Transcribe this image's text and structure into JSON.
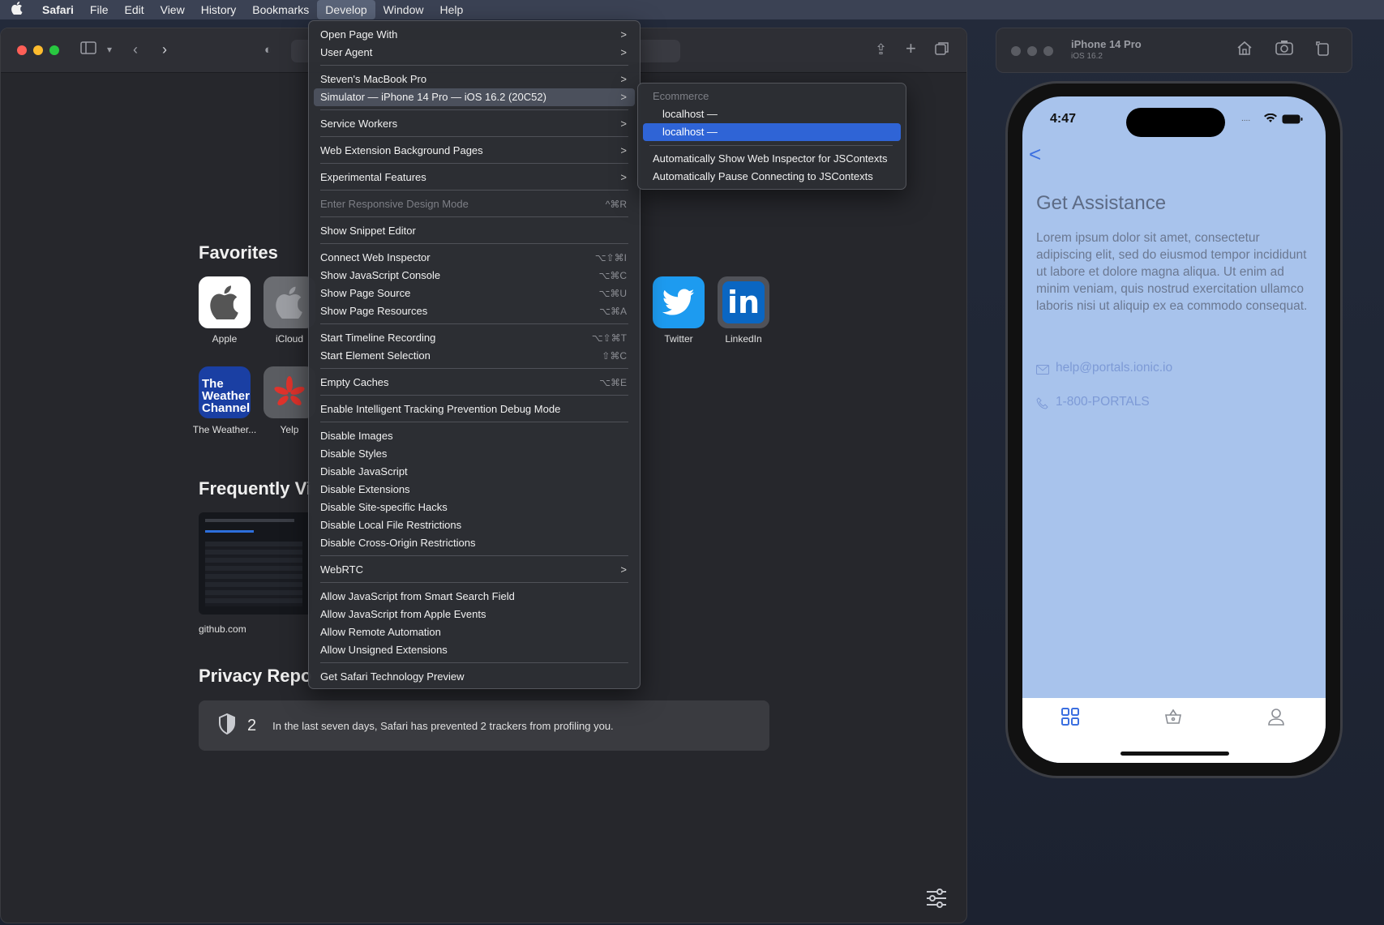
{
  "menubar": {
    "items": [
      "Safari",
      "File",
      "Edit",
      "View",
      "History",
      "Bookmarks",
      "Develop",
      "Window",
      "Help"
    ],
    "active": "Develop"
  },
  "safari": {
    "favorites_title": "Favorites",
    "favorites": [
      {
        "label": "Apple"
      },
      {
        "label": "iCloud"
      },
      {
        "label": "Twitter"
      },
      {
        "label": "LinkedIn"
      },
      {
        "label": "The Weather..."
      },
      {
        "label": "Yelp"
      }
    ],
    "weather_tile_text": "The Weather Channel",
    "linkedin_tile_text": "in",
    "frequently_title": "Frequently Vi",
    "frequent_site": "github.com",
    "privacy_title": "Privacy Repo",
    "privacy_count": "2",
    "privacy_text": "In the last seven days, Safari has prevented 2 trackers from profiling you."
  },
  "develop_menu": {
    "items": [
      {
        "label": "Open Page With",
        "arrow": ">"
      },
      {
        "label": "User Agent",
        "arrow": ">"
      },
      {
        "label": "Steven's MacBook Pro",
        "arrow": ">"
      },
      {
        "label": "Simulator — iPhone 14 Pro — iOS 16.2 (20C52)",
        "arrow": ">"
      },
      {
        "label": "Service Workers",
        "arrow": ">"
      },
      {
        "label": "Web Extension Background Pages",
        "arrow": ">"
      },
      {
        "label": "Experimental Features",
        "arrow": ">"
      },
      {
        "label": "Enter Responsive Design Mode",
        "shortcut": "^⌘R"
      },
      {
        "label": "Show Snippet Editor"
      },
      {
        "label": "Connect Web Inspector",
        "shortcut": "⌥⇧⌘I"
      },
      {
        "label": "Show JavaScript Console",
        "shortcut": "⌥⌘C"
      },
      {
        "label": "Show Page Source",
        "shortcut": "⌥⌘U"
      },
      {
        "label": "Show Page Resources",
        "shortcut": "⌥⌘A"
      },
      {
        "label": "Start Timeline Recording",
        "shortcut": "⌥⇧⌘T"
      },
      {
        "label": "Start Element Selection",
        "shortcut": "⇧⌘C"
      },
      {
        "label": "Empty Caches",
        "shortcut": "⌥⌘E"
      },
      {
        "label": "Enable Intelligent Tracking Prevention Debug Mode"
      },
      {
        "label": "Disable Images"
      },
      {
        "label": "Disable Styles"
      },
      {
        "label": "Disable JavaScript"
      },
      {
        "label": "Disable Extensions"
      },
      {
        "label": "Disable Site-specific Hacks"
      },
      {
        "label": "Disable Local File Restrictions"
      },
      {
        "label": "Disable Cross-Origin Restrictions"
      },
      {
        "label": "WebRTC",
        "arrow": ">"
      },
      {
        "label": "Allow JavaScript from Smart Search Field"
      },
      {
        "label": "Allow JavaScript from Apple Events"
      },
      {
        "label": "Allow Remote Automation"
      },
      {
        "label": "Allow Unsigned Extensions"
      },
      {
        "label": "Get Safari Technology Preview"
      }
    ]
  },
  "submenu": {
    "header": "Ecommerce",
    "item1": "localhost —",
    "item2": "localhost —",
    "auto_show": "Automatically Show Web Inspector for JSContexts",
    "auto_pause": "Automatically Pause Connecting to JSContexts"
  },
  "simulator": {
    "device": "iPhone 14 Pro",
    "os": "iOS 16.2",
    "time": "4:47",
    "title": "Get Assistance",
    "body": "Lorem ipsum dolor sit amet, consectetur adipiscing elit, sed do eiusmod tempor incididunt ut labore et dolore magna aliqua. Ut enim ad minim veniam, quis nostrud exercitation ullamco laboris nisi ut aliquip ex ea commodo consequat.",
    "email": "help@portals.ionic.io",
    "phone": "1-800-PORTALS",
    "back": "<"
  },
  "colors": {
    "selection": "#2f64d6",
    "screen_bg": "#a8c3ec",
    "link": "#5b87e0"
  }
}
